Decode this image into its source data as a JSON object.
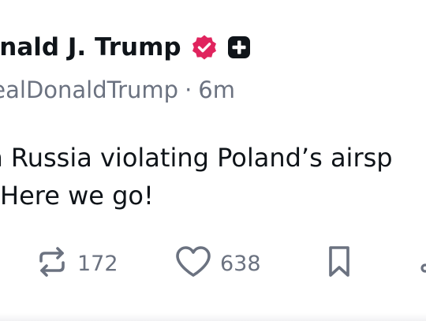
{
  "post": {
    "display_name": "onald J. Trump",
    "handle": "realDonaldTrump",
    "separator": "·",
    "timestamp": "6m",
    "body_line1": "ith Russia violating Poland’s airsp",
    "body_line2": "Here we go!",
    "badges": {
      "verified_icon": "verified-check-icon",
      "verified_color": "#e0245e",
      "app_icon": "plus-square-icon"
    }
  },
  "actions": {
    "repost": {
      "icon": "repost-icon",
      "count": "172"
    },
    "like": {
      "icon": "heart-icon",
      "count": "638"
    },
    "bookmark": {
      "icon": "bookmark-icon"
    },
    "more": {
      "icon": "share-icon"
    }
  }
}
